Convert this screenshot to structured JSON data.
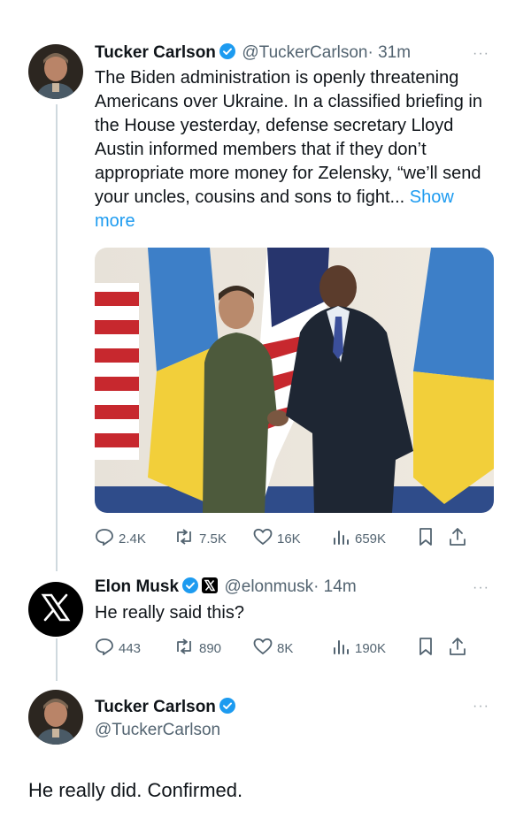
{
  "tweet1": {
    "name": "Tucker Carlson",
    "handle": "@TuckerCarlson",
    "time": "· 31m",
    "text": "The Biden administration is openly threatening Americans over Ukraine. In a classified briefing in the House yesterday, defense secretary Lloyd Austin informed members that if they don’t appropriate more money for Zelensky, “we’ll send your uncles, cousins and sons to fight...",
    "show_more": "Show more",
    "stats": {
      "replies": "2.4K",
      "reposts": "7.5K",
      "likes": "16K",
      "views": "659K"
    }
  },
  "tweet2": {
    "name": "Elon Musk",
    "handle": "@elonmusk",
    "time": "· 14m",
    "text": "He really said this?",
    "stats": {
      "replies": "443",
      "reposts": "890",
      "likes": "8K",
      "views": "190K"
    }
  },
  "tweet3": {
    "name": "Tucker Carlson",
    "handle": "@TuckerCarlson",
    "text": "He really did. Confirmed."
  },
  "more_label": "···",
  "colors": {
    "accent": "#1d9bf0",
    "muted": "#536471",
    "text": "#0f1419"
  }
}
